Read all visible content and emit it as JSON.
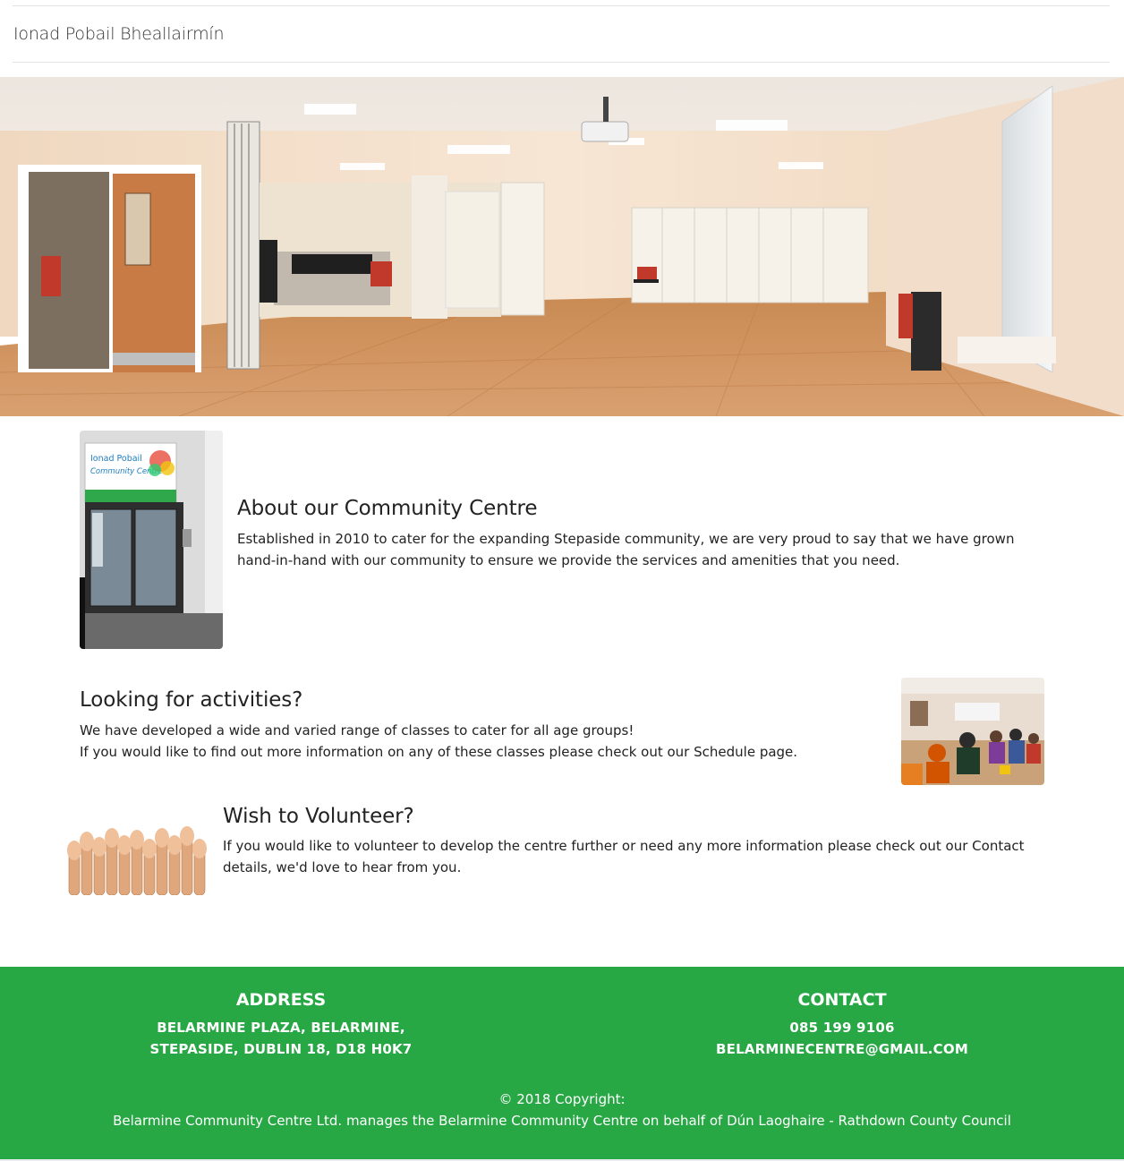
{
  "nav": {
    "brand": "Ionad Pobail Bheallairmín"
  },
  "hero": {
    "image_name": "community-hall-panorama"
  },
  "about": {
    "heading": "About our Community Centre",
    "text": "Established in 2010 to cater for the expanding Stepaside community, we are very proud to say that we have grown hand-in-hand with our community to ensure we provide the services and amenities that you need.",
    "image_name": "centre-entrance-photo",
    "sign_line1": "Ionad Pobail",
    "sign_line2": "Community Centre"
  },
  "activities": {
    "heading": "Looking for activities?",
    "line1": "We have developed a wide and varied range of classes to cater for all age groups!",
    "line2": "If you would like to find out more information on any of these classes please check out our Schedule page.",
    "image_name": "class-activity-photo"
  },
  "volunteer": {
    "heading": "Wish to Volunteer?",
    "text": "If you would like to volunteer to develop the centre further or need any more information please check out our Contact details, we'd love to hear from you.",
    "image_name": "raised-hands-photo"
  },
  "footer": {
    "address_title": "ADDRESS",
    "address_line1": "BELARMINE PLAZA, BELARMINE,",
    "address_line2": "STEPASIDE, DUBLIN 18, D18 H0K7",
    "contact_title": "CONTACT",
    "phone": "085 199 9106",
    "email": "BELARMINECENTRE@GMAIL.COM",
    "copyright": "© 2018 Copyright:",
    "managed_by": "Belarmine Community Centre Ltd. manages the Belarmine Community Centre on behalf of Dún Laoghaire - Rathdown County Council"
  },
  "colors": {
    "footer_bg": "#28a745",
    "footer_text": "#ffffff",
    "heading_text": "#222222"
  }
}
